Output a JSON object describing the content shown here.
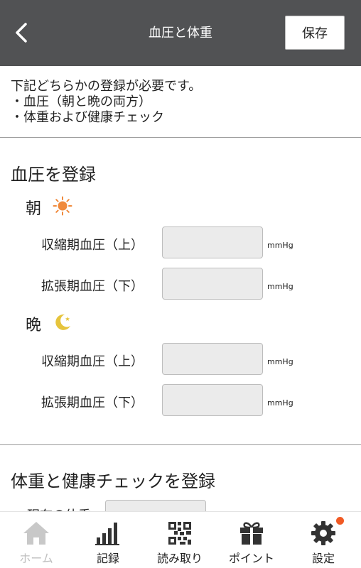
{
  "header": {
    "title": "血圧と体重",
    "save_label": "保存"
  },
  "notice": {
    "line1": "下記どちらかの登録が必要です。",
    "line2": "・血圧（朝と晩の両方）",
    "line3": "・体重および健康チェック"
  },
  "blood_pressure": {
    "title": "血圧を登録",
    "morning": {
      "label": "朝",
      "icon": "sun-icon",
      "systolic_label": "収縮期血圧（上）",
      "systolic_value": "",
      "diastolic_label": "拡張期血圧（下）",
      "diastolic_value": ""
    },
    "evening": {
      "label": "晩",
      "icon": "moon-icon",
      "systolic_label": "収縮期血圧（上）",
      "systolic_value": "",
      "diastolic_label": "拡張期血圧（下）",
      "diastolic_value": ""
    },
    "unit": "mmHg"
  },
  "weight": {
    "title": "体重と健康チェックを登録",
    "current_weight_label": "現在の体重",
    "current_weight_value": ""
  },
  "nav": {
    "items": [
      {
        "label": "ホーム",
        "icon": "home-icon",
        "active": true
      },
      {
        "label": "記録",
        "icon": "bar-chart-icon",
        "active": false
      },
      {
        "label": "読み取り",
        "icon": "qr-code-icon",
        "active": false
      },
      {
        "label": "ポイント",
        "icon": "gift-icon",
        "active": false
      },
      {
        "label": "設定",
        "icon": "gear-icon",
        "active": false,
        "badge": true
      }
    ]
  },
  "colors": {
    "header_bg": "#515254",
    "sun": "#f08a3c",
    "moon": "#e6c43c",
    "badge": "#f15a24",
    "input_bg": "#ebebeb"
  }
}
